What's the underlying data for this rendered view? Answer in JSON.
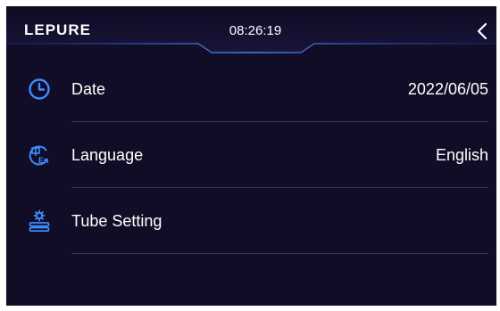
{
  "header": {
    "logo": "LEPURE",
    "time": "08:26:19"
  },
  "settings": [
    {
      "label": "Date",
      "value": "2022/06/05",
      "icon": "clock-icon"
    },
    {
      "label": "Language",
      "value": "English",
      "icon": "language-icon"
    },
    {
      "label": "Tube Setting",
      "value": "",
      "icon": "tube-setting-icon"
    }
  ],
  "colors": {
    "background": "#120d26",
    "accent": "#3d8bff",
    "text": "#ffffff",
    "divider": "#3a3550"
  }
}
